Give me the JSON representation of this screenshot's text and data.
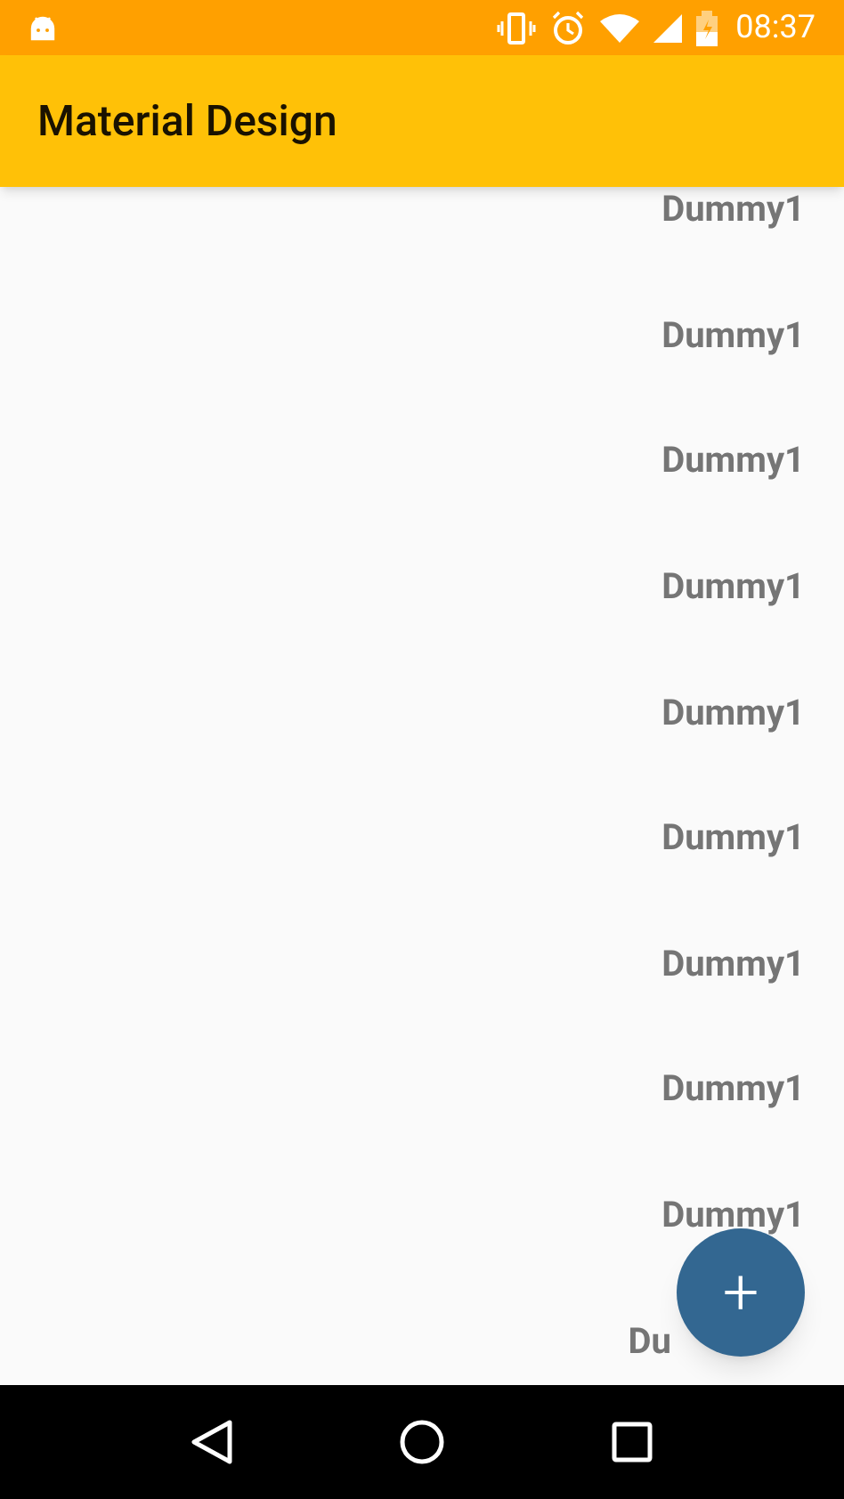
{
  "status_bar": {
    "time": "08:37"
  },
  "app_bar": {
    "title": "Material Design"
  },
  "list": {
    "items": [
      {
        "label": "Dummy1"
      },
      {
        "label": "Dummy1"
      },
      {
        "label": "Dummy1"
      },
      {
        "label": "Dummy1"
      },
      {
        "label": "Dummy1"
      },
      {
        "label": "Dummy1"
      },
      {
        "label": "Dummy1"
      },
      {
        "label": "Dummy1"
      },
      {
        "label": "Dummy1"
      },
      {
        "label": "Du",
        "kind": "covered"
      }
    ]
  },
  "fab": {
    "icon": "+"
  }
}
